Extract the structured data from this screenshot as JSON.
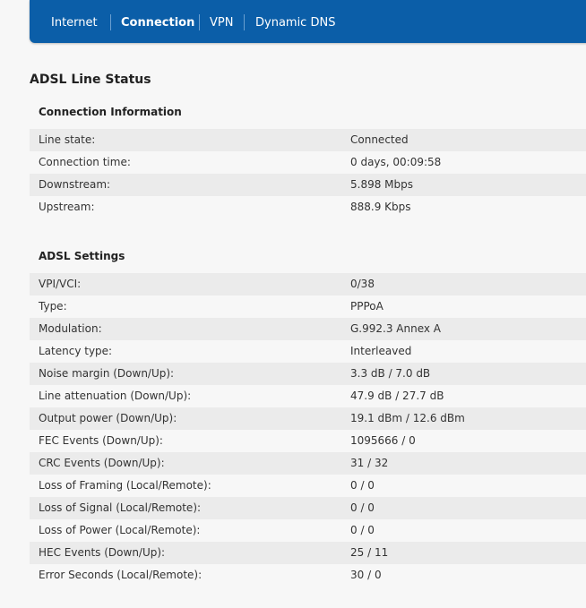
{
  "nav": {
    "items": [
      {
        "label": "Internet"
      },
      {
        "label": "Connection"
      },
      {
        "label": "VPN"
      },
      {
        "label": "Dynamic DNS"
      }
    ]
  },
  "page_title": "ADSL Line Status",
  "connection_info": {
    "title": "Connection Information",
    "rows": [
      {
        "label": "Line state:",
        "value": "Connected"
      },
      {
        "label": "Connection time:",
        "value": "0 days, 00:09:58"
      },
      {
        "label": "Downstream:",
        "value": "5.898 Mbps"
      },
      {
        "label": "Upstream:",
        "value": "888.9 Kbps"
      }
    ]
  },
  "adsl_settings": {
    "title": "ADSL Settings",
    "rows": [
      {
        "label": "VPI/VCI:",
        "value": "0/38"
      },
      {
        "label": "Type:",
        "value": "PPPoA"
      },
      {
        "label": "Modulation:",
        "value": "G.992.3 Annex A"
      },
      {
        "label": "Latency type:",
        "value": "Interleaved"
      },
      {
        "label": "Noise margin (Down/Up):",
        "value": "3.3 dB / 7.0 dB"
      },
      {
        "label": "Line attenuation (Down/Up):",
        "value": "47.9 dB / 27.7 dB"
      },
      {
        "label": "Output power (Down/Up):",
        "value": "19.1 dBm / 12.6 dBm"
      },
      {
        "label": "FEC Events (Down/Up):",
        "value": "1095666 / 0"
      },
      {
        "label": "CRC Events (Down/Up):",
        "value": "31 / 32"
      },
      {
        "label": "Loss of Framing (Local/Remote):",
        "value": "0 / 0"
      },
      {
        "label": "Loss of Signal (Local/Remote):",
        "value": "0 / 0"
      },
      {
        "label": "Loss of Power (Local/Remote):",
        "value": "0 / 0"
      },
      {
        "label": "HEC Events (Down/Up):",
        "value": "25 / 11"
      },
      {
        "label": "Error Seconds (Local/Remote):",
        "value": "30 / 0"
      }
    ]
  }
}
